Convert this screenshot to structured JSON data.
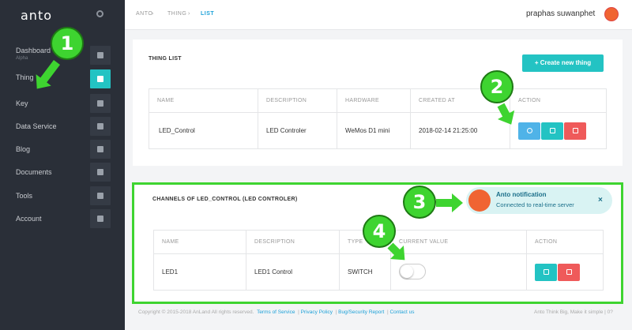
{
  "sidebar": {
    "logo": "anto",
    "items": [
      {
        "label": "Dashboard",
        "sub": "Alpha",
        "icon": "gauge-icon"
      },
      {
        "label": "Thing",
        "icon": "thing-icon",
        "active": true
      },
      {
        "label": "Key",
        "icon": "key-icon"
      },
      {
        "label": "Data Service",
        "icon": "database-icon"
      },
      {
        "label": "Blog",
        "icon": "blog-icon"
      },
      {
        "label": "Documents",
        "icon": "document-icon"
      },
      {
        "label": "Tools",
        "icon": "wrench-icon"
      },
      {
        "label": "Account",
        "icon": "user-icon"
      }
    ]
  },
  "breadcrumb": [
    "ANTO",
    "THING",
    "LIST"
  ],
  "user": {
    "name": "praphas suwanphet"
  },
  "thing_list": {
    "title": "THING LIST",
    "create_label": "+ Create new thing",
    "columns": [
      "NAME",
      "DESCRIPTION",
      "HARDWARE",
      "CREATED AT",
      "ACTION"
    ],
    "rows": [
      {
        "name": "LED_Control",
        "description": "LED Controler",
        "hardware": "WeMos D1 mini",
        "created": "2018-02-14 21:25:00"
      }
    ]
  },
  "channels": {
    "title": "CHANNELS OF LED_CONTROL (LED CONTROLER)",
    "columns": [
      "NAME",
      "DESCRIPTION",
      "TYPE",
      "CURRENT VALUE",
      "ACTION"
    ],
    "rows": [
      {
        "name": "LED1",
        "description": "LED1 Control",
        "type": "SWITCH",
        "value": "off"
      }
    ]
  },
  "notification": {
    "title": "Anto notification",
    "message": "Connected to real-time server",
    "close": "×"
  },
  "annotations": [
    "1",
    "2",
    "3",
    "4"
  ],
  "footer": {
    "copyright": "Copyright © 2015-2018 AnLand All rights reserved.",
    "links": [
      "Terms of Service",
      "Privacy Policy",
      "Bug/Security Report",
      "Contact us"
    ],
    "tagline": "Anto Think Big, Make it simple | 0?"
  },
  "colors": {
    "accent": "#23c3c3",
    "sidebar": "#2a2f38",
    "annotation": "#3ed430",
    "danger": "#ef5a5a",
    "info": "#4fb3e8"
  }
}
